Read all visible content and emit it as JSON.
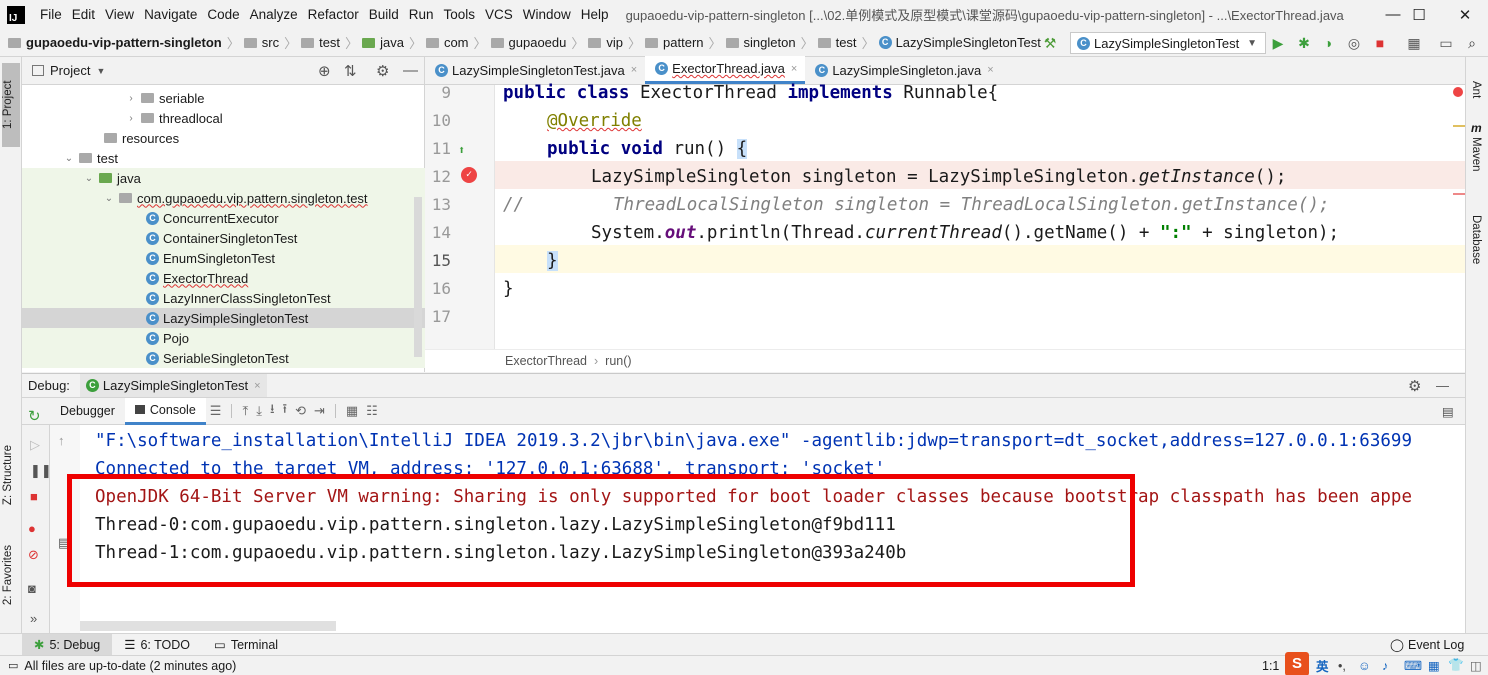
{
  "menubar": {
    "app_icon": "IJ",
    "items": [
      "File",
      "Edit",
      "View",
      "Navigate",
      "Code",
      "Analyze",
      "Refactor",
      "Build",
      "Run",
      "Tools",
      "VCS",
      "Window",
      "Help"
    ],
    "title": "gupaoedu-vip-pattern-singleton [...\\02.单例模式及原型模式\\课堂源码\\gupaoedu-vip-pattern-singleton] - ...\\ExectorThread.java",
    "minimize": "—",
    "maximize": "☐",
    "close": "✕"
  },
  "navbar": {
    "crumbs": [
      "gupaoedu-vip-pattern-singleton",
      "src",
      "test",
      "java",
      "com",
      "gupaoedu",
      "vip",
      "pattern",
      "singleton",
      "test",
      "LazySimpleSingletonTest"
    ],
    "run_config": "LazySimpleSingletonTest",
    "icons": [
      "hammer-icon",
      "run-icon",
      "debug-icon",
      "coverage-icon",
      "profile-icon",
      "stop-icon",
      "project-structure-icon",
      "terminal-icon",
      "search-icon"
    ]
  },
  "left_stripe": {
    "project_tab": "1: Project",
    "structure_tab": "Z: Structure",
    "favorites_tab": "2: Favorites"
  },
  "project": {
    "header": "Project",
    "tree": [
      {
        "label": "seriable",
        "type": "folder",
        "expandable": true
      },
      {
        "label": "threadlocal",
        "type": "folder",
        "expandable": true
      },
      {
        "label": "resources",
        "type": "folder",
        "expandable": false
      },
      {
        "label": "test",
        "type": "folder",
        "expandable": true,
        "expanded": true
      },
      {
        "label": "java",
        "type": "folder-green",
        "expandable": true,
        "expanded": true
      },
      {
        "label": "com.gupaoedu.vip.pattern.singleton.test",
        "type": "package",
        "expandable": true,
        "expanded": true
      },
      {
        "label": "ConcurrentExecutor",
        "type": "class"
      },
      {
        "label": "ContainerSingletonTest",
        "type": "class"
      },
      {
        "label": "EnumSingletonTest",
        "type": "class"
      },
      {
        "label": "ExectorThread",
        "type": "class"
      },
      {
        "label": "LazyInnerClassSingletonTest",
        "type": "class"
      },
      {
        "label": "LazySimpleSingletonTest",
        "type": "class",
        "selected": true
      },
      {
        "label": "Pojo",
        "type": "class"
      },
      {
        "label": "SeriableSingletonTest",
        "type": "class"
      }
    ]
  },
  "editor": {
    "tabs": [
      {
        "label": "LazySimpleSingletonTest.java",
        "close": "×"
      },
      {
        "label": "ExectorThread.java",
        "close": "×",
        "active": true
      },
      {
        "label": "LazySimpleSingleton.java",
        "close": "×"
      }
    ],
    "line_numbers": [
      "9",
      "10",
      "11",
      "12",
      "13",
      "14",
      "15",
      "16",
      "17"
    ],
    "code": {
      "l9_kw": "public class",
      "l9_name": " ExectorThread ",
      "l9_impl": "implements",
      "l9_rest": " Runnable{",
      "l10": "@Override",
      "l11_kw": "public void",
      "l11_rest": " run() ",
      "l11_brace": "{",
      "l12_a": "LazySimpleSingleton singleton = LazySimpleSingleton.",
      "l12_b": "getInstance",
      "l12_c": "();",
      "l13_prefix": "//",
      "l13_body": "ThreadLocalSingleton singleton = ThreadLocalSingleton.getInstance();",
      "l14_a": "System.",
      "l14_out": "out",
      "l14_b": ".println(Thread.",
      "l14_ct": "currentThread",
      "l14_c": "().getName() + ",
      "l14_str": "\":\"",
      "l14_d": " + singleton);",
      "l15": "}",
      "l16": "}"
    },
    "breadcrumb": [
      "ExectorThread",
      "run()"
    ]
  },
  "right_stripe": {
    "tabs": [
      "Ant",
      "Maven",
      "Database"
    ]
  },
  "debug": {
    "title": "Debug:",
    "session_tab": "LazySimpleSingletonTest",
    "tabs": [
      "Debugger",
      "Console"
    ],
    "active_tab": "Console",
    "console_lines": [
      {
        "text": "\"F:\\software_installation\\IntelliJ IDEA 2019.3.2\\jbr\\bin\\java.exe\" -agentlib:jdwp=transport=dt_socket,address=127.0.0.1:63699",
        "kind": "cmd"
      },
      {
        "text": "Connected to the target VM, address: '127.0.0.1:63688', transport: 'socket'",
        "kind": "cmd"
      },
      {
        "text": "OpenJDK 64-Bit Server VM warning: Sharing is only supported for boot loader classes because bootstrap classpath has been appe",
        "kind": "err"
      },
      {
        "text": "Thread-0:com.gupaoedu.vip.pattern.singleton.lazy.LazySimpleSingleton@f9bd111",
        "kind": "out"
      },
      {
        "text": "Thread-1:com.gupaoedu.vip.pattern.singleton.lazy.LazySimpleSingleton@393a240b",
        "kind": "out"
      }
    ],
    "highlight_color": "#ee0000"
  },
  "bottom_toolbar": {
    "debug": "5: Debug",
    "todo": "6: TODO",
    "terminal": "Terminal",
    "event_log": "Event Log"
  },
  "status": {
    "message": "All files are up-to-date (2 minutes ago)",
    "position": "1:1",
    "ime_logo": "S",
    "ime_lang": "英"
  }
}
